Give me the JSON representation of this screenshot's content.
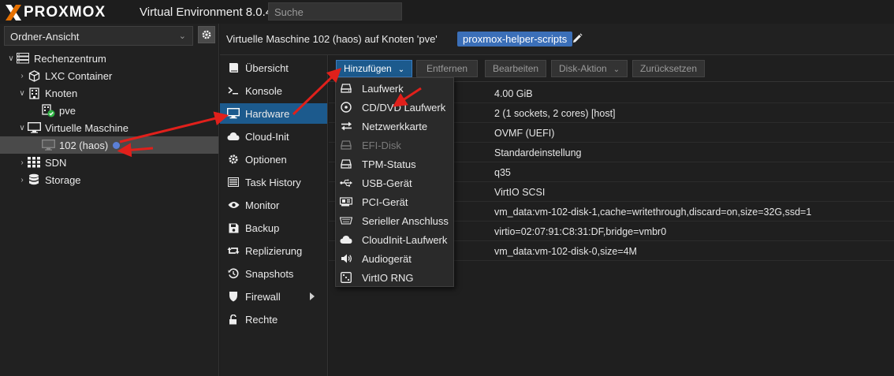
{
  "header": {
    "logo_text": "PROXMOX",
    "product_title": "Virtual Environment 8.0.4",
    "search_placeholder": "Suche"
  },
  "sidebar": {
    "view_select": "Ordner-Ansicht",
    "tree": [
      {
        "label": "Rechenzentrum",
        "icon": "datacenter-icon",
        "expanded": true
      },
      {
        "label": "LXC Container",
        "icon": "cube-icon",
        "expanded": false
      },
      {
        "label": "Knoten",
        "icon": "building-icon",
        "expanded": true
      },
      {
        "label": "pve",
        "icon": "node-online-icon"
      },
      {
        "label": "Virtuelle Maschine",
        "icon": "monitor-icon",
        "expanded": true
      },
      {
        "label": "102 (haos)",
        "icon": "vm-icon",
        "selected": true
      },
      {
        "label": "SDN",
        "icon": "grid-icon",
        "expanded": false
      },
      {
        "label": "Storage",
        "icon": "database-icon",
        "expanded": false
      }
    ]
  },
  "content": {
    "title": "Virtuelle Maschine 102 (haos) auf Knoten 'pve'",
    "tag": "proxmox-helper-scripts"
  },
  "nav": {
    "items": [
      {
        "label": "Übersicht",
        "icon": "book-icon"
      },
      {
        "label": "Konsole",
        "icon": "terminal-icon"
      },
      {
        "label": "Hardware",
        "icon": "desktop-icon",
        "active": true
      },
      {
        "label": "Cloud-Init",
        "icon": "cloud-icon"
      },
      {
        "label": "Optionen",
        "icon": "gear-icon"
      },
      {
        "label": "Task History",
        "icon": "list-icon"
      },
      {
        "label": "Monitor",
        "icon": "eye-icon"
      },
      {
        "label": "Backup",
        "icon": "floppy-icon"
      },
      {
        "label": "Replizierung",
        "icon": "retweet-icon"
      },
      {
        "label": "Snapshots",
        "icon": "history-icon"
      },
      {
        "label": "Firewall",
        "icon": "shield-icon",
        "has_submenu": true
      },
      {
        "label": "Rechte",
        "icon": "unlock-icon"
      }
    ]
  },
  "toolbar": {
    "add_label": "Hinzufügen",
    "remove_label": "Entfernen",
    "edit_label": "Bearbeiten",
    "disk_action_label": "Disk-Aktion",
    "revert_label": "Zurücksetzen"
  },
  "hardware_values": [
    "4.00 GiB",
    "2 (1 sockets, 2 cores) [host]",
    "OVMF (UEFI)",
    "Standardeinstellung",
    "q35",
    "VirtIO SCSI",
    "vm_data:vm-102-disk-1,cache=writethrough,discard=on,size=32G,ssd=1",
    "virtio=02:07:91:C8:31:DF,bridge=vmbr0",
    "vm_data:vm-102-disk-0,size=4M"
  ],
  "add_menu": {
    "items": [
      {
        "label": "Laufwerk",
        "icon": "hdd-icon"
      },
      {
        "label": "CD/DVD Laufwerk",
        "icon": "cd-icon"
      },
      {
        "label": "Netzwerkkarte",
        "icon": "exchange-icon"
      },
      {
        "label": "EFI-Disk",
        "icon": "hdd-icon",
        "disabled": true
      },
      {
        "label": "TPM-Status",
        "icon": "hdd-icon"
      },
      {
        "label": "USB-Gerät",
        "icon": "usb-icon"
      },
      {
        "label": "PCI-Gerät",
        "icon": "pci-card-icon"
      },
      {
        "label": "Serieller Anschluss",
        "icon": "serial-port-icon"
      },
      {
        "label": "CloudInit-Laufwerk",
        "icon": "cloud-icon"
      },
      {
        "label": "Audiogerät",
        "icon": "volume-icon"
      },
      {
        "label": "VirtIO RNG",
        "icon": "dice-icon"
      }
    ]
  },
  "colors": {
    "accent_blue": "#1c5a8d",
    "tag_blue": "#3b6fb8",
    "annotation_red": "#e0201b",
    "node_online_green": "#2fb344"
  }
}
